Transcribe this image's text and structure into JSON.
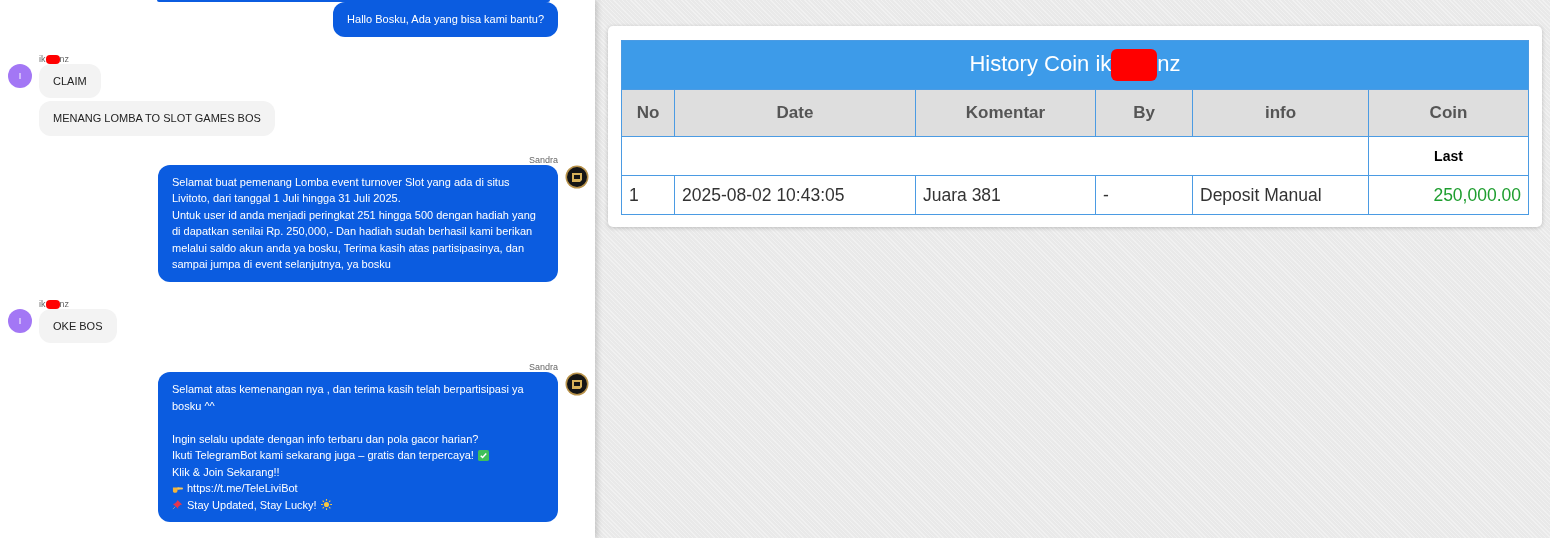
{
  "chat": {
    "previous_bubble_visible": true,
    "messages": [
      {
        "kind": "outgoing",
        "bubbles": [
          {
            "blocks": [
              [
                {
                  "text": "Hallo Bosku, Ada yang bisa kami bantu?"
                }
              ]
            ]
          }
        ]
      },
      {
        "kind": "incoming",
        "sender_parts": [
          "ik",
          "nz"
        ],
        "avatar": "I",
        "bubbles": [
          {
            "blocks": [
              [
                {
                  "text": "CLAIM"
                }
              ]
            ]
          },
          {
            "blocks": [
              [
                {
                  "text": "MENANG LOMBA TO SLOT GAMES BOS"
                }
              ]
            ]
          }
        ]
      },
      {
        "kind": "outgoing",
        "sender": "Sandra",
        "bubbles": [
          {
            "blocks": [
              [
                {
                  "text": "Selamat buat pemenang Lomba event turnover Slot yang ada di situs Livitoto, dari tanggal 1 Juli hingga 31 Juli 2025."
                },
                {
                  "text": "Untuk user id anda menjadi peringkat 251 hingga 500 dengan hadiah yang di dapatkan senilai Rp. 250,000,- Dan hadiah sudah berhasil kami berikan melalui saldo akun anda ya bosku, Terima kasih atas partisipasinya, dan sampai jumpa di event selanjutnya, ya bosku"
                }
              ]
            ]
          }
        ]
      },
      {
        "kind": "incoming",
        "sender_parts": [
          "ik",
          "nz"
        ],
        "avatar": "I",
        "bubbles": [
          {
            "blocks": [
              [
                {
                  "text": "OKE BOS"
                }
              ]
            ]
          }
        ]
      },
      {
        "kind": "outgoing",
        "sender": "Sandra",
        "bubbles": [
          {
            "blocks": [
              [
                {
                  "text": "Selamat atas kemenangan nya , dan terima kasih telah berpartisipasi ya bosku ^^"
                }
              ],
              [
                {
                  "text": "Ingin selalu update dengan info terbaru dan pola gacor harian?"
                },
                {
                  "text": "Ikuti TelegramBot kami sekarang juga – gratis dan terpercaya!",
                  "icon_after": {
                    "kind": "check"
                  }
                },
                {
                  "text": "Klik & Join Sekarang!!"
                },
                {
                  "text": "https://t.me/TeleLiviBot",
                  "icon_before": {
                    "kind": "point"
                  }
                },
                {
                  "text": "Stay Updated, Stay Lucky!",
                  "icon_before": {
                    "kind": "pin"
                  },
                  "icon_after": {
                    "kind": "sun"
                  }
                }
              ]
            ]
          }
        ]
      }
    ]
  },
  "history": {
    "title_parts": [
      "History Coin ik",
      "nz"
    ],
    "columns": [
      "No",
      "Date",
      "Komentar",
      "By",
      "info",
      "Coin"
    ],
    "summary_label": "Last",
    "rows": [
      {
        "no": "1",
        "date": "2025-08-02 10:43:05",
        "komentar": "Juara 381",
        "by": "-",
        "info": "Deposit Manual",
        "coin": "250,000.00"
      }
    ]
  }
}
